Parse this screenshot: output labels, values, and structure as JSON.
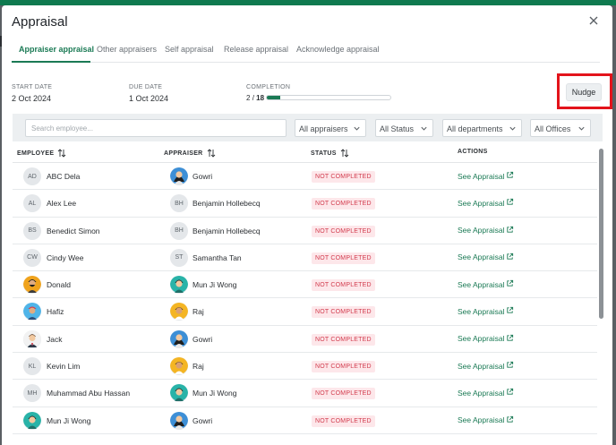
{
  "modal": {
    "title": "Appraisal"
  },
  "tabs": [
    {
      "label": "Appraiser appraisal"
    },
    {
      "label": "Other appraisers"
    },
    {
      "label": "Self appraisal"
    },
    {
      "label": "Release appraisal"
    },
    {
      "label": "Acknowledge appraisal"
    }
  ],
  "meta": {
    "start_label": "START DATE",
    "start_value": "2 Oct 2024",
    "due_label": "DUE DATE",
    "due_value": "1 Oct 2024",
    "completion_label": "COMPLETION",
    "completion_done": "2",
    "completion_sep": "/",
    "completion_total": "18",
    "completion_fraction": 0.111
  },
  "nudge_label": "Nudge",
  "filters": {
    "search_placeholder": "Search employee...",
    "appraisers": "All appraisers",
    "status": "All Status",
    "departments": "All departments",
    "offices": "All Offices"
  },
  "columns": {
    "employee": "EMPLOYEE",
    "appraiser": "APPRAISER",
    "status": "STATUS",
    "actions": "ACTIONS"
  },
  "colors": {
    "accent": "#1b7a55",
    "badge_bg": "#fde7ea",
    "badge_text": "#d23b4d",
    "highlight": "#e3131b"
  },
  "rows": [
    {
      "employee": "ABC Dela",
      "emp_initials": "AD",
      "emp_avatar": "initials",
      "appraiser": "Gowri",
      "apr_initials": "",
      "apr_avatar": "woman-avatar",
      "status": "NOT COMPLETED",
      "action": "See Appraisal"
    },
    {
      "employee": "Alex Lee",
      "emp_initials": "AL",
      "emp_avatar": "initials",
      "appraiser": "Benjamin Hollebecq",
      "apr_initials": "BH",
      "apr_avatar": "initials",
      "status": "NOT COMPLETED",
      "action": "See Appraisal"
    },
    {
      "employee": "Benedict Simon",
      "emp_initials": "BS",
      "emp_avatar": "initials",
      "appraiser": "Benjamin Hollebecq",
      "apr_initials": "BH",
      "apr_avatar": "initials",
      "status": "NOT COMPLETED",
      "action": "See Appraisal"
    },
    {
      "employee": "Cindy Wee",
      "emp_initials": "CW",
      "emp_avatar": "initials",
      "appraiser": "Samantha Tan",
      "apr_initials": "ST",
      "apr_avatar": "initials",
      "status": "NOT COMPLETED",
      "action": "See Appraisal"
    },
    {
      "employee": "Donald",
      "emp_initials": "",
      "emp_avatar": "man-beard-avatar",
      "appraiser": "Mun Ji Wong",
      "apr_initials": "",
      "apr_avatar": "teal-avatar",
      "status": "NOT COMPLETED",
      "action": "See Appraisal"
    },
    {
      "employee": "Hafiz",
      "emp_initials": "",
      "emp_avatar": "man-cap-avatar",
      "appraiser": "Raj",
      "apr_initials": "",
      "apr_avatar": "yellow-avatar",
      "status": "NOT COMPLETED",
      "action": "See Appraisal"
    },
    {
      "employee": "Jack",
      "emp_initials": "",
      "emp_avatar": "man-suit-avatar",
      "appraiser": "Gowri",
      "apr_initials": "",
      "apr_avatar": "woman-avatar",
      "status": "NOT COMPLETED",
      "action": "See Appraisal"
    },
    {
      "employee": "Kevin Lim",
      "emp_initials": "KL",
      "emp_avatar": "initials",
      "appraiser": "Raj",
      "apr_initials": "",
      "apr_avatar": "yellow-avatar",
      "status": "NOT COMPLETED",
      "action": "See Appraisal"
    },
    {
      "employee": "Muhammad Abu Hassan",
      "emp_initials": "MH",
      "emp_avatar": "initials",
      "appraiser": "Mun Ji Wong",
      "apr_initials": "",
      "apr_avatar": "teal-avatar",
      "status": "NOT COMPLETED",
      "action": "See Appraisal"
    },
    {
      "employee": "Mun Ji Wong",
      "emp_initials": "",
      "emp_avatar": "teal-avatar",
      "appraiser": "Gowri",
      "apr_initials": "",
      "apr_avatar": "woman-avatar",
      "status": "NOT COMPLETED",
      "action": "See Appraisal"
    }
  ]
}
